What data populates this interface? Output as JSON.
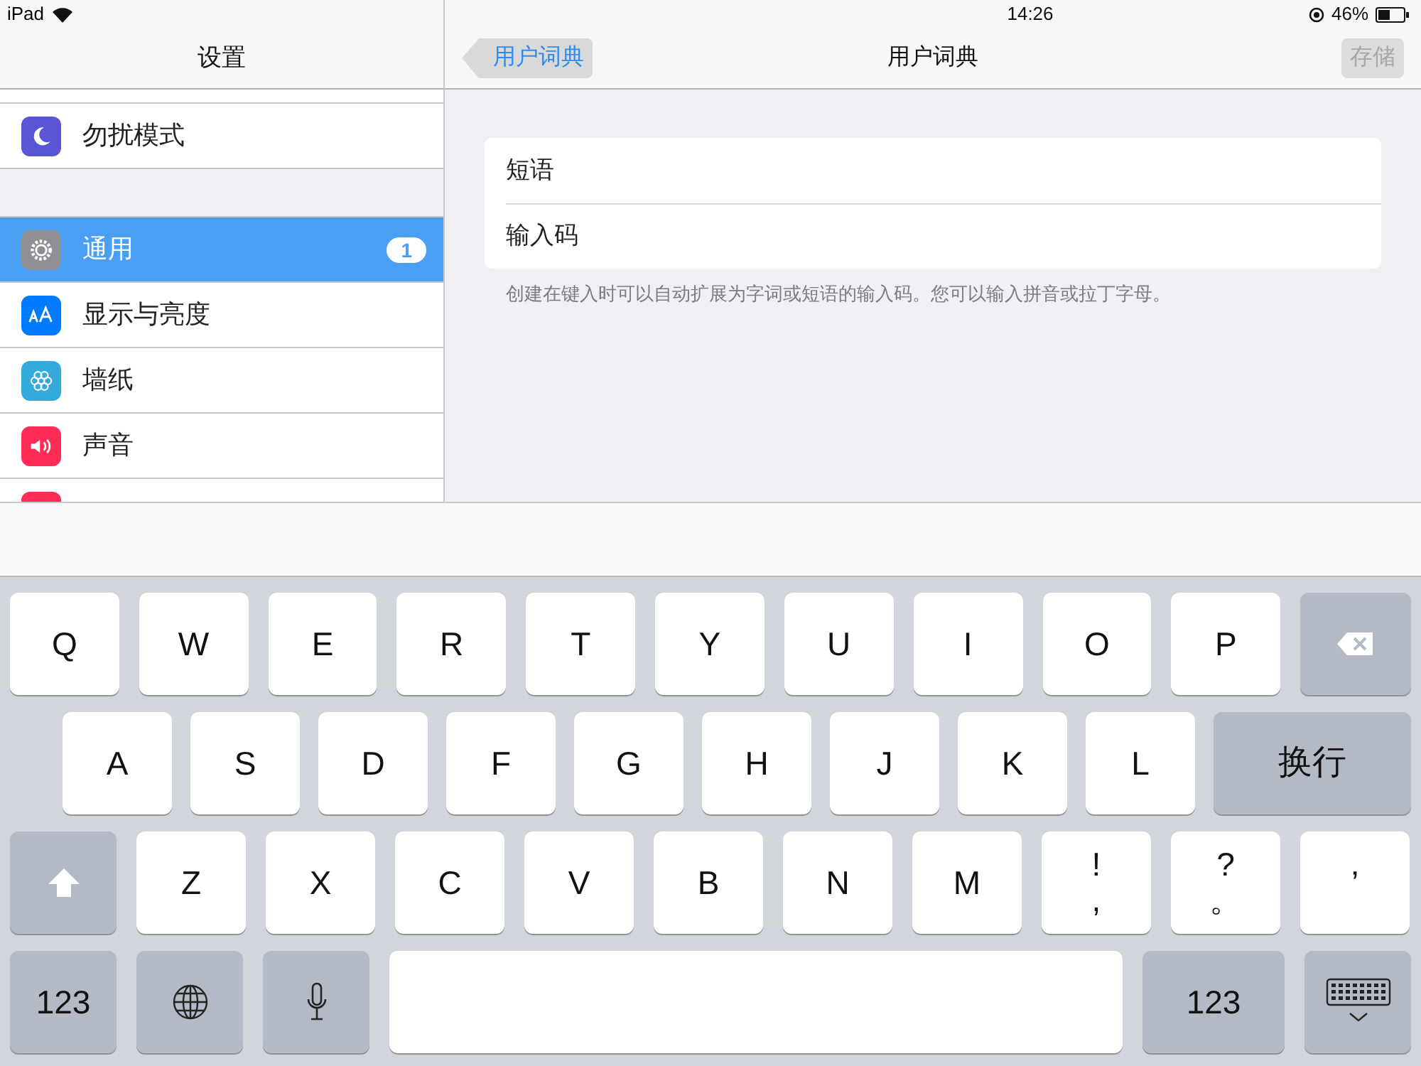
{
  "status_bar": {
    "device": "iPad",
    "time": "14:26",
    "battery": "46%"
  },
  "sidebar": {
    "title": "设置",
    "groups": [
      [
        {
          "kind": "moon",
          "label": "勿扰模式",
          "color": "#5856d6",
          "selected": false
        }
      ],
      [
        {
          "kind": "gear",
          "label": "通用",
          "color": "#8e8e93",
          "selected": true,
          "badge": "1"
        },
        {
          "kind": "text-size",
          "label": "显示与亮度",
          "color": "#007aff",
          "selected": false
        },
        {
          "kind": "flower",
          "label": "墙纸",
          "color": "#34aadc",
          "selected": false
        },
        {
          "kind": "speaker",
          "label": "声音",
          "color": "#ff2d55",
          "selected": false
        },
        {
          "kind": "blank",
          "color": "#ff2d55",
          "selected": false
        }
      ]
    ]
  },
  "detail": {
    "back": "用户词典",
    "title": "用户词典",
    "save": {
      "label": "存储",
      "disabled": true
    },
    "fields": [
      {
        "placeholder": "短语"
      },
      {
        "placeholder": "输入码"
      }
    ],
    "footer": "创建在键入时可以自动扩展为字词或短语的输入码。您可以输入拼音或拉丁字母。"
  },
  "keyboard": {
    "rows": [
      {
        "keys": [
          {
            "kind": "letter",
            "label": "Q"
          },
          {
            "kind": "letter",
            "label": "W"
          },
          {
            "kind": "letter",
            "label": "E"
          },
          {
            "kind": "letter",
            "label": "R"
          },
          {
            "kind": "letter",
            "label": "T"
          },
          {
            "kind": "letter",
            "label": "Y"
          },
          {
            "kind": "letter",
            "label": "U"
          },
          {
            "kind": "letter",
            "label": "I"
          },
          {
            "kind": "letter",
            "label": "O"
          },
          {
            "kind": "letter",
            "label": "P"
          },
          {
            "kind": "backspace"
          }
        ]
      },
      {
        "keys": [
          {
            "kind": "letter",
            "label": "A"
          },
          {
            "kind": "letter",
            "label": "S"
          },
          {
            "kind": "letter",
            "label": "D"
          },
          {
            "kind": "letter",
            "label": "F"
          },
          {
            "kind": "letter",
            "label": "G"
          },
          {
            "kind": "letter",
            "label": "H"
          },
          {
            "kind": "letter",
            "label": "J"
          },
          {
            "kind": "letter",
            "label": "K"
          },
          {
            "kind": "letter",
            "label": "L"
          },
          {
            "kind": "return",
            "label": "换行"
          }
        ]
      },
      {
        "keys": [
          {
            "kind": "shift"
          },
          {
            "kind": "letter",
            "label": "Z"
          },
          {
            "kind": "letter",
            "label": "X"
          },
          {
            "kind": "letter",
            "label": "C"
          },
          {
            "kind": "letter",
            "label": "V"
          },
          {
            "kind": "letter",
            "label": "B"
          },
          {
            "kind": "letter",
            "label": "N"
          },
          {
            "kind": "letter",
            "label": "M"
          },
          {
            "kind": "letter",
            "label": "!",
            "sublabel": ","
          },
          {
            "kind": "letter",
            "label": "?",
            "sublabel": "。"
          },
          {
            "kind": "letter",
            "label": "’"
          }
        ]
      },
      {
        "keys": [
          {
            "kind": "mode",
            "label": "123"
          },
          {
            "kind": "globe"
          },
          {
            "kind": "mic"
          },
          {
            "kind": "space"
          },
          {
            "kind": "mode-wide",
            "label": "123"
          },
          {
            "kind": "dismiss"
          }
        ]
      }
    ]
  }
}
